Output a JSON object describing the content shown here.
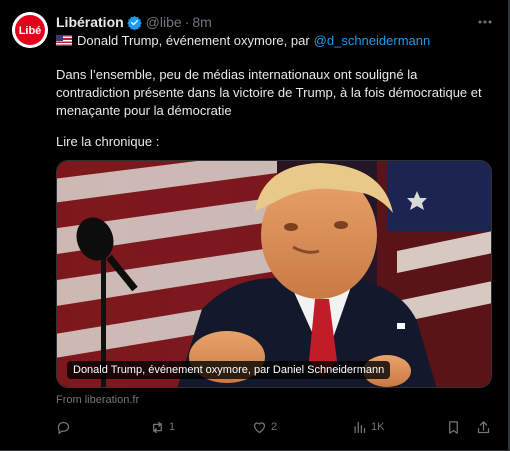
{
  "tweet": {
    "display_name": "Libération",
    "handle": "@libe",
    "separator": "·",
    "time": "8m",
    "avatar_text": "Libé",
    "headline_text": "Donald Trump, événement oxymore, par",
    "headline_mention": "@d_schneidermann",
    "body": "Dans l’ensemble, peu de médias internationaux ont souligné la contradiction présente dans la victoire de Trump, à la fois démocratique et menaçante pour la démocratie",
    "cta": "Lire la chronique :",
    "card": {
      "caption": "Donald Trump, événement oxymore, par Daniel Schneidermann"
    },
    "source": "From liberation.fr",
    "actions": {
      "replies": "",
      "reposts": "1",
      "likes": "2",
      "views": "1K"
    }
  },
  "icons": [
    "avatar",
    "verified-badge-icon",
    "more-icon",
    "us-flag-icon",
    "reply-icon",
    "repost-icon",
    "like-icon",
    "views-icon",
    "bookmark-icon",
    "share-icon"
  ],
  "colors": {
    "background": "#000000",
    "text": "#e7e9ea",
    "muted": "#71767b",
    "accent": "#1d9bf0",
    "brand_red": "#e2001a"
  }
}
